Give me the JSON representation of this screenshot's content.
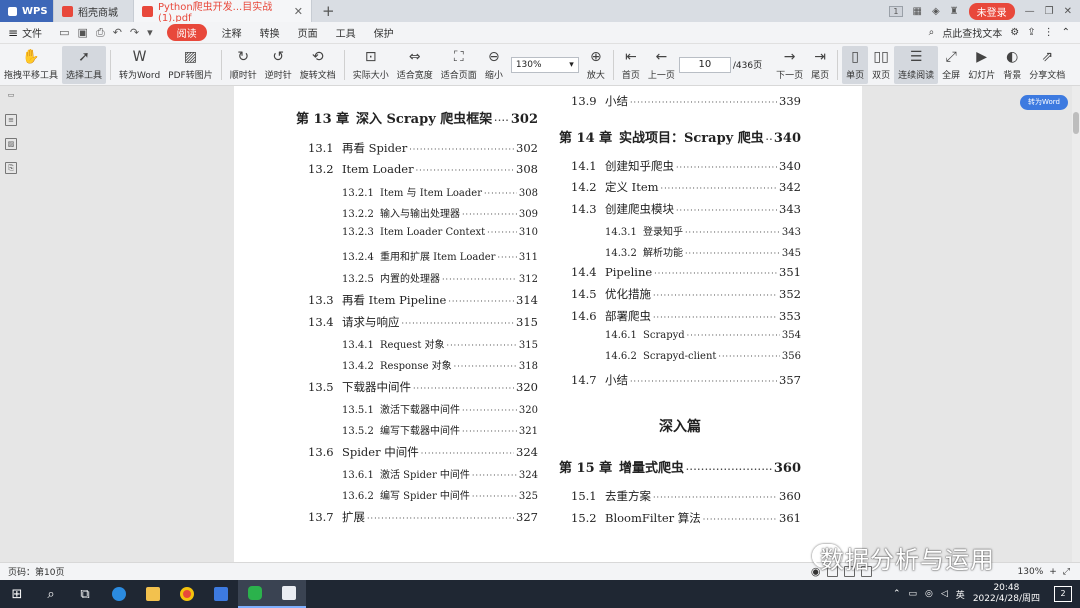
{
  "tabs": {
    "wps": "WPS",
    "store": "稻壳商城",
    "document": "Python爬虫开发...目实战(1).pdf",
    "add": "+",
    "badge": "1",
    "login": "未登录"
  },
  "menubar": {
    "file": "文件",
    "items": [
      "阅读",
      "注释",
      "转换",
      "页面",
      "工具",
      "保护"
    ],
    "search": "点此查找文本"
  },
  "toolbar": {
    "pan": "拖拽平移工具",
    "select": "选择工具",
    "to_word": "转为Word",
    "pdf_to_image": "PDF转图片",
    "rotate_cw": "顺时针",
    "rotate_ccw": "逆时针",
    "rotate_doc": "旋转文档",
    "actual_size": "实际大小",
    "fit_width": "适合宽度",
    "fit_page": "适合页面",
    "zoom_out": "缩小",
    "zoom_value": "130%",
    "zoom_in": "放大",
    "first_page": "首页",
    "prev_page": "上一页",
    "page_current": "10",
    "page_total": "/436页",
    "next_page": "下一页",
    "last_page": "尾页",
    "single": "单页",
    "double": "双页",
    "continuous": "连续阅读",
    "fullscreen": "全屏",
    "slideshow": "幻灯片",
    "background": "背景",
    "share": "分享文档"
  },
  "convert_word_button": "转为Word",
  "toc_left": [
    {
      "kind": "chap",
      "num": "第 13 章",
      "title": "深入 Scrapy 爬虫框架",
      "page": "302"
    },
    {
      "kind": "sec",
      "num": "13.1",
      "title": "再看 Spider",
      "page": "302"
    },
    {
      "kind": "sec",
      "num": "13.2",
      "title": "Item Loader",
      "page": "308"
    },
    {
      "kind": "sub",
      "num": "13.2.1",
      "title": "Item 与 Item Loader",
      "page": "308"
    },
    {
      "kind": "sub",
      "num": "13.2.2",
      "title": "输入与输出处理器",
      "page": "309"
    },
    {
      "kind": "sub",
      "num": "13.2.3",
      "title": "Item Loader Context",
      "page": "310"
    },
    {
      "kind": "sub",
      "num": "13.2.4",
      "title": "重用和扩展 Item Loader",
      "page": "311"
    },
    {
      "kind": "sub",
      "num": "13.2.5",
      "title": "内置的处理器",
      "page": "312"
    },
    {
      "kind": "sec",
      "num": "13.3",
      "title": "再看 Item Pipeline",
      "page": "314"
    },
    {
      "kind": "sec",
      "num": "13.4",
      "title": "请求与响应",
      "page": "315"
    },
    {
      "kind": "sub",
      "num": "13.4.1",
      "title": "Request 对象",
      "page": "315"
    },
    {
      "kind": "sub",
      "num": "13.4.2",
      "title": "Response 对象",
      "page": "318"
    },
    {
      "kind": "sec",
      "num": "13.5",
      "title": "下载器中间件",
      "page": "320"
    },
    {
      "kind": "sub",
      "num": "13.5.1",
      "title": "激活下载器中间件",
      "page": "320"
    },
    {
      "kind": "sub",
      "num": "13.5.2",
      "title": "编写下载器中间件",
      "page": "321"
    },
    {
      "kind": "sec",
      "num": "13.6",
      "title": "Spider 中间件",
      "page": "324"
    },
    {
      "kind": "sub",
      "num": "13.6.1",
      "title": "激活 Spider 中间件",
      "page": "324"
    },
    {
      "kind": "sub",
      "num": "13.6.2",
      "title": "编写 Spider 中间件",
      "page": "325"
    },
    {
      "kind": "sec",
      "num": "13.7",
      "title": "扩展",
      "page": "327"
    }
  ],
  "toc_right": [
    {
      "kind": "sec",
      "num": "13.9",
      "title": "小结",
      "page": "339"
    },
    {
      "kind": "chap",
      "num": "第 14 章",
      "title": "实战项目：Scrapy 爬虫",
      "page": "340"
    },
    {
      "kind": "sec",
      "num": "14.1",
      "title": "创建知乎爬虫",
      "page": "340"
    },
    {
      "kind": "sec",
      "num": "14.2",
      "title": "定义 Item",
      "page": "342"
    },
    {
      "kind": "sec",
      "num": "14.3",
      "title": "创建爬虫模块",
      "page": "343"
    },
    {
      "kind": "sub",
      "num": "14.3.1",
      "title": "登录知乎",
      "page": "343"
    },
    {
      "kind": "sub",
      "num": "14.3.2",
      "title": "解析功能",
      "page": "345"
    },
    {
      "kind": "sec",
      "num": "14.4",
      "title": "Pipeline",
      "page": "351"
    },
    {
      "kind": "sec",
      "num": "14.5",
      "title": "优化措施",
      "page": "352"
    },
    {
      "kind": "sec",
      "num": "14.6",
      "title": "部署爬虫",
      "page": "353"
    },
    {
      "kind": "sub",
      "num": "14.6.1",
      "title": "Scrapyd",
      "page": "354"
    },
    {
      "kind": "sub",
      "num": "14.6.2",
      "title": "Scrapyd-client",
      "page": "356"
    },
    {
      "kind": "sec",
      "num": "14.7",
      "title": "小结",
      "page": "357"
    },
    {
      "kind": "part",
      "title": "深入篇"
    },
    {
      "kind": "chap",
      "num": "第 15 章",
      "title": "增量式爬虫",
      "page": "360"
    },
    {
      "kind": "sec",
      "num": "15.1",
      "title": "去重方案",
      "page": "360"
    },
    {
      "kind": "sec",
      "num": "15.2",
      "title": "BloomFilter 算法",
      "page": "361"
    }
  ],
  "statusbar": {
    "page_label": "页码：第10页",
    "zoom": "130%"
  },
  "watermark": "数据分析与运用",
  "taskbar": {
    "ime": "英",
    "time": "20:48",
    "date": "2022/4/28/周四",
    "notifications": "2"
  }
}
